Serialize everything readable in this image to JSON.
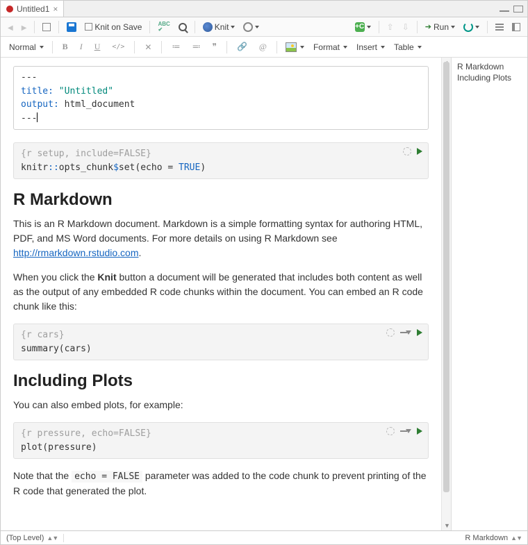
{
  "tab": {
    "title": "Untitled1"
  },
  "toolbar": {
    "knit_on_save": "Knit on Save",
    "knit": "Knit",
    "run": "Run",
    "normal": "Normal",
    "format": "Format",
    "insert": "Insert",
    "table": "Table",
    "bold": "B",
    "italic": "I",
    "underline": "U",
    "code": "</>",
    "clear": "✕",
    "ul": "≔",
    "ol": "≕",
    "quote": "❞",
    "link": "🔗",
    "at": "@",
    "plus_c": "+C"
  },
  "outline": {
    "items": [
      "R Markdown",
      "Including Plots"
    ]
  },
  "yaml": {
    "dash": "---",
    "title_key": "title:",
    "title_val": "\"Untitled\"",
    "output_key": "output:",
    "output_val": "html_document"
  },
  "chunks": {
    "setup": {
      "header": "{r setup, include=FALSE}",
      "code_pre": "knitr",
      "code_op": "::",
      "code_fn": "opts_chunk",
      "code_op2": "$",
      "code_fn2": "set",
      "code_paren": "(echo = ",
      "code_true": "TRUE",
      "code_close": ")"
    },
    "cars": {
      "header": "{r cars}",
      "code": "summary(cars)"
    },
    "pressure": {
      "header": "{r pressure, echo=FALSE}",
      "code": "plot(pressure)"
    }
  },
  "headings": {
    "h1a": "R Markdown",
    "h1b": "Including Plots"
  },
  "paras": {
    "p1a": "This is an R Markdown document. Markdown is a simple formatting syntax for authoring HTML, PDF, and MS Word documents. For more details on using R Markdown see ",
    "p1link": "http://rmarkdown.rstudio.com",
    "p1b": ".",
    "p2a": "When you click the ",
    "p2knit": "Knit",
    "p2b": " button a document will be generated that includes both content as well as the output of any embedded R code chunks within the document. You can embed an R code chunk like this:",
    "p3": "You can also embed plots, for example:",
    "p4a": "Note that the ",
    "p4code": "echo = FALSE",
    "p4b": " parameter was added to the code chunk to prevent printing of the R code that generated the plot."
  },
  "status": {
    "left": "(Top Level)",
    "right": "R Markdown"
  }
}
